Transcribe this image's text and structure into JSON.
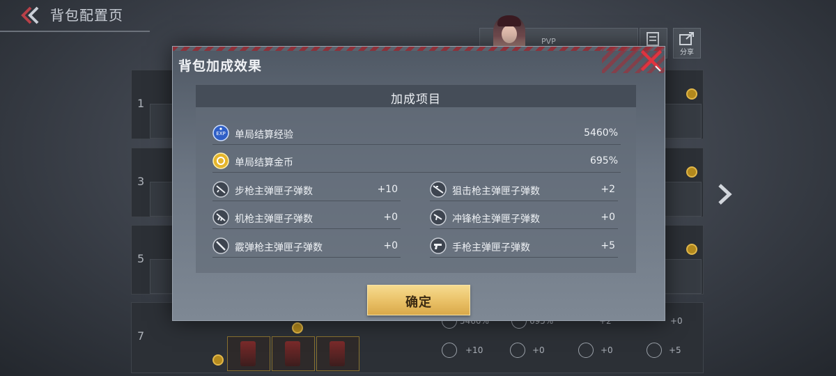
{
  "page": {
    "title": "背包配置页"
  },
  "top_panel": {
    "mode_label": "PVP",
    "share_label": "分享"
  },
  "slots": {
    "numbers": [
      "1",
      "3",
      "5",
      "7"
    ]
  },
  "background_stats": {
    "row1": [
      "5460%",
      "695%",
      "+2",
      "+0"
    ],
    "row2": [
      "+10",
      "+0",
      "+0",
      "+5"
    ]
  },
  "modal": {
    "title": "背包加成效果",
    "section_header": "加成项目",
    "full_rows": [
      {
        "icon": "exp-icon",
        "label": "单局结算经验",
        "value": "5460%"
      },
      {
        "icon": "gold-coin-icon",
        "label": "单局结算金币",
        "value": "695%"
      }
    ],
    "left_rows": [
      {
        "icon": "rifle-icon",
        "label": "步枪主弹匣子弹数",
        "value": "+10"
      },
      {
        "icon": "machine-gun-icon",
        "label": "机枪主弹匣子弹数",
        "value": "+0"
      },
      {
        "icon": "shotgun-icon",
        "label": "霰弹枪主弹匣子弹数",
        "value": "+0"
      }
    ],
    "right_rows": [
      {
        "icon": "sniper-icon",
        "label": "狙击枪主弹匣子弹数",
        "value": "+2"
      },
      {
        "icon": "smg-icon",
        "label": "冲锋枪主弹匣子弹数",
        "value": "+0"
      },
      {
        "icon": "pistol-icon",
        "label": "手枪主弹匣子弹数",
        "value": "+5"
      }
    ],
    "confirm_label": "确定"
  },
  "colors": {
    "accent_red": "#d8323e",
    "confirm_gold": "#e9c066",
    "exp_blue": "#2f5fc6"
  }
}
